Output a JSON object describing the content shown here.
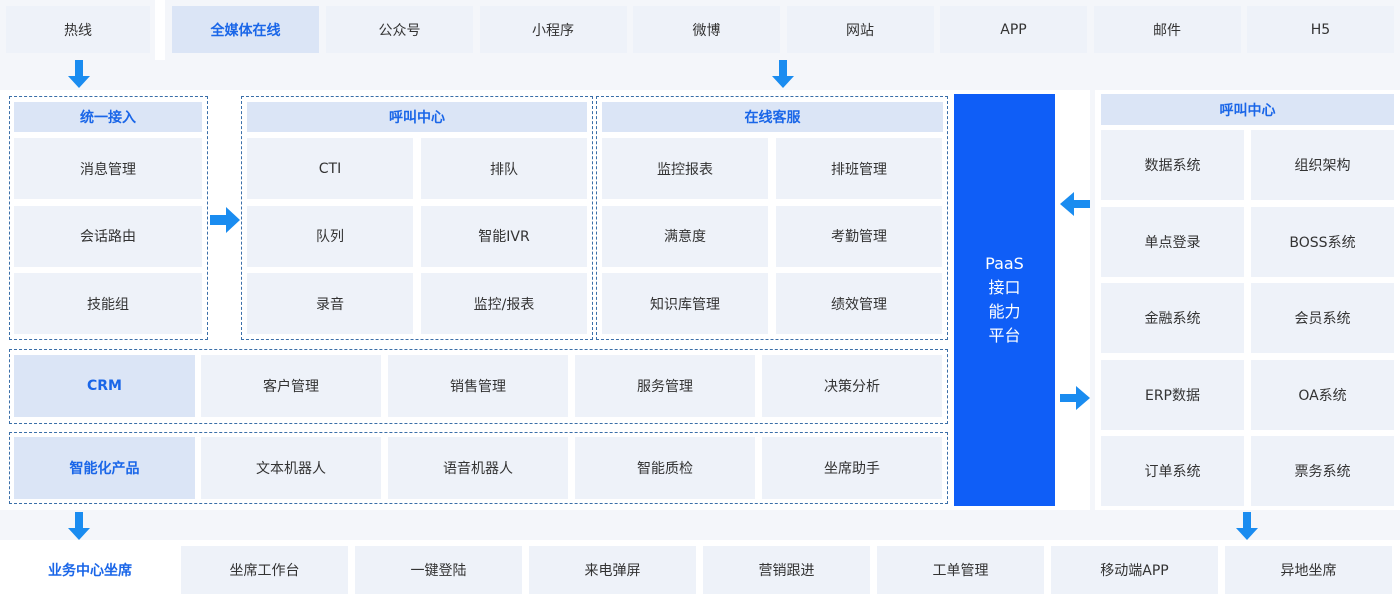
{
  "top": {
    "hotline": "热线",
    "omnichannel": "全媒体在线",
    "channels": [
      "公众号",
      "小程序",
      "微博",
      "网站",
      "APP",
      "邮件",
      "H5"
    ]
  },
  "unified_access": {
    "title": "统一接入",
    "items": [
      "消息管理",
      "会话路由",
      "技能组"
    ]
  },
  "call_center": {
    "title": "呼叫中心",
    "items": [
      "CTI",
      "排队",
      "队列",
      "智能IVR",
      "录音",
      "监控/报表"
    ]
  },
  "online_service": {
    "title": "在线客服",
    "items": [
      "监控报表",
      "排班管理",
      "满意度",
      "考勤管理",
      "知识库管理",
      "绩效管理"
    ]
  },
  "crm": {
    "title": "CRM",
    "items": [
      "客户管理",
      "销售管理",
      "服务管理",
      "决策分析"
    ]
  },
  "smart_products": {
    "title": "智能化产品",
    "items": [
      "文本机器人",
      "语音机器人",
      "智能质检",
      "坐席助手"
    ]
  },
  "paas": {
    "lines": [
      "PaaS",
      "接口",
      "能力",
      "平台"
    ]
  },
  "right_panel": {
    "title": "呼叫中心",
    "items": [
      "数据系统",
      "组织架构",
      "单点登录",
      "BOSS系统",
      "金融系统",
      "会员系统",
      "ERP数据",
      "OA系统",
      "订单系统",
      "票务系统"
    ]
  },
  "bottom": {
    "title": "业务中心坐席",
    "items": [
      "坐席工作台",
      "一键登陆",
      "来电弹屏",
      "营销跟进",
      "工单管理",
      "移动端APP",
      "异地坐席"
    ]
  },
  "colors": {
    "accent": "#1a66e8",
    "paas": "#0f5ef7",
    "cell": "#eef2f9",
    "header": "#dbe5f6",
    "arrow": "#1a8cf0"
  }
}
